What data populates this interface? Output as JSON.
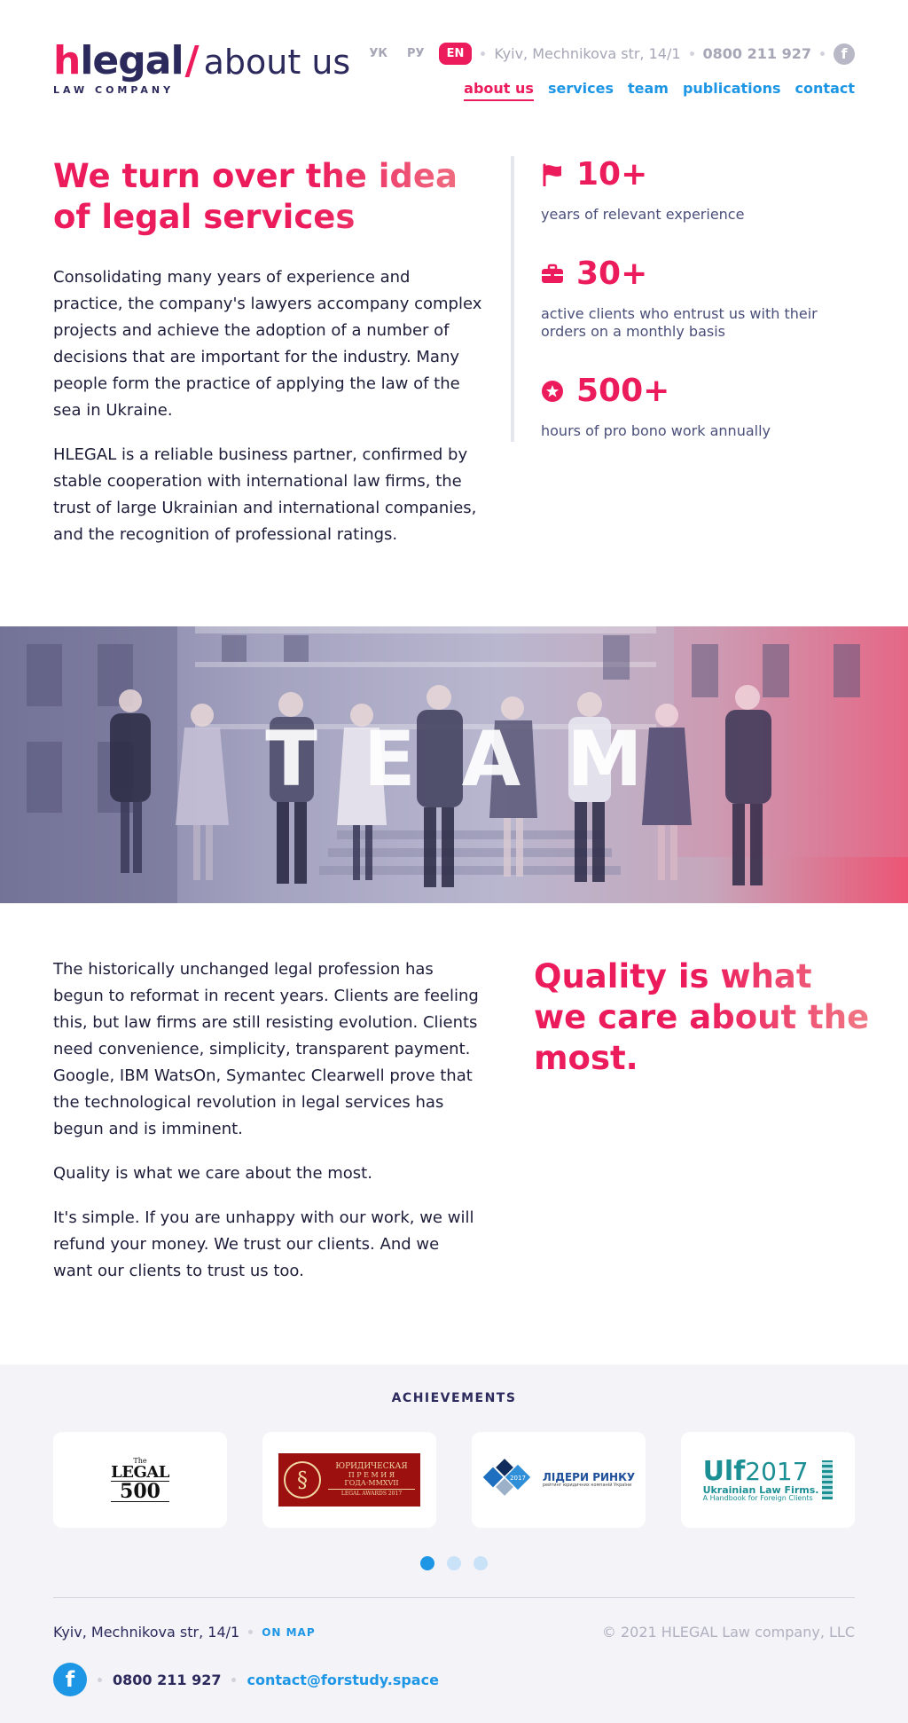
{
  "header": {
    "logo": {
      "brand_h": "h",
      "brand_rest": "legal",
      "slash": "/",
      "page": "about us",
      "sub": "LAW COMPANY"
    },
    "languages": [
      {
        "code": "УК",
        "active": false
      },
      {
        "code": "РУ",
        "active": false
      },
      {
        "code": "EN",
        "active": true
      }
    ],
    "address": "Kyiv, Mechnikova str, 14/1",
    "phone": "0800 211 927",
    "facebook_icon": "facebook-icon",
    "nav": [
      {
        "label": "about us",
        "active": true
      },
      {
        "label": "services",
        "active": false
      },
      {
        "label": "team",
        "active": false
      },
      {
        "label": "publications",
        "active": false
      },
      {
        "label": "contact",
        "active": false
      }
    ]
  },
  "intro": {
    "headline": "We turn over the idea of legal services",
    "paragraphs": [
      "Consolidating many years of experience and practice, the company's lawyers accompany complex projects and achieve the adoption of a number of decisions that are important for the industry. Many people form the practice of applying the law of the sea in Ukraine.",
      "HLEGAL is a reliable business partner, confirmed by stable cooperation with international law firms, the trust of large Ukrainian and international companies, and the recognition of professional ratings."
    ]
  },
  "stats": [
    {
      "icon": "flag-icon",
      "value": "10+",
      "desc": "years of relevant experience"
    },
    {
      "icon": "briefcase-icon",
      "value": "30+",
      "desc": "active clients who entrust us with their orders on a monthly basis"
    },
    {
      "icon": "star-badge-icon",
      "value": "500+",
      "desc": "hours of pro bono work annually"
    }
  ],
  "team_banner": {
    "label": "TEAM"
  },
  "quality": {
    "paragraphs": [
      "The historically unchanged legal profession has begun to reformat in recent years. Clients are feeling this, but law firms are still resisting evolution. Clients need convenience, simplicity, transparent payment. Google, IBM WatsOn, Symantec Clearwell prove that the technological revolution in legal services has begun and is imminent.",
      "Quality is what we care about the most.",
      "It's simple. If you are unhappy with our work, we will refund your money. We trust our clients. And we want our clients to trust us too."
    ],
    "headline": "Quality is what we care about the most."
  },
  "achievements": {
    "title": "ACHIEVEMENTS",
    "logos": [
      {
        "name": "legal500-logo",
        "line1": "The",
        "line2": "LEGAL",
        "line3": "500"
      },
      {
        "name": "legal-awards-logo",
        "line1": "ЮРИДИЧЕСКАЯ",
        "line2": "П Р Е М И Я",
        "line3": "ГОДА·MMXVII",
        "line4": "LEGAL AWARDS 2017"
      },
      {
        "name": "market-leaders-logo",
        "badge": "2017",
        "line1": "ЛІДЕРИ РИНКУ",
        "line2": "рейтинг юридичних компаній України"
      },
      {
        "name": "ulf-logo",
        "line1": "Ulf",
        "line2": "2017",
        "line3": "Ukrainian Law Firms.",
        "line4": "A Handbook for Foreign Clients"
      }
    ],
    "slider_dots": 3,
    "active_dot": 0
  },
  "footer": {
    "address": "Kyiv, Mechnikova str, 14/1",
    "on_map": "ON MAP",
    "copyright": "© 2021 HLEGAL Law company, LLC",
    "phone": "0800 211 927",
    "email": "contact@forstudy.space",
    "facebook_icon": "facebook-icon"
  },
  "colors": {
    "accent": "#ec1b5c",
    "link": "#1e96e6",
    "navy": "#2c2a5c",
    "muted": "#a6a6b6",
    "footer_bg": "#f3f3f8"
  }
}
